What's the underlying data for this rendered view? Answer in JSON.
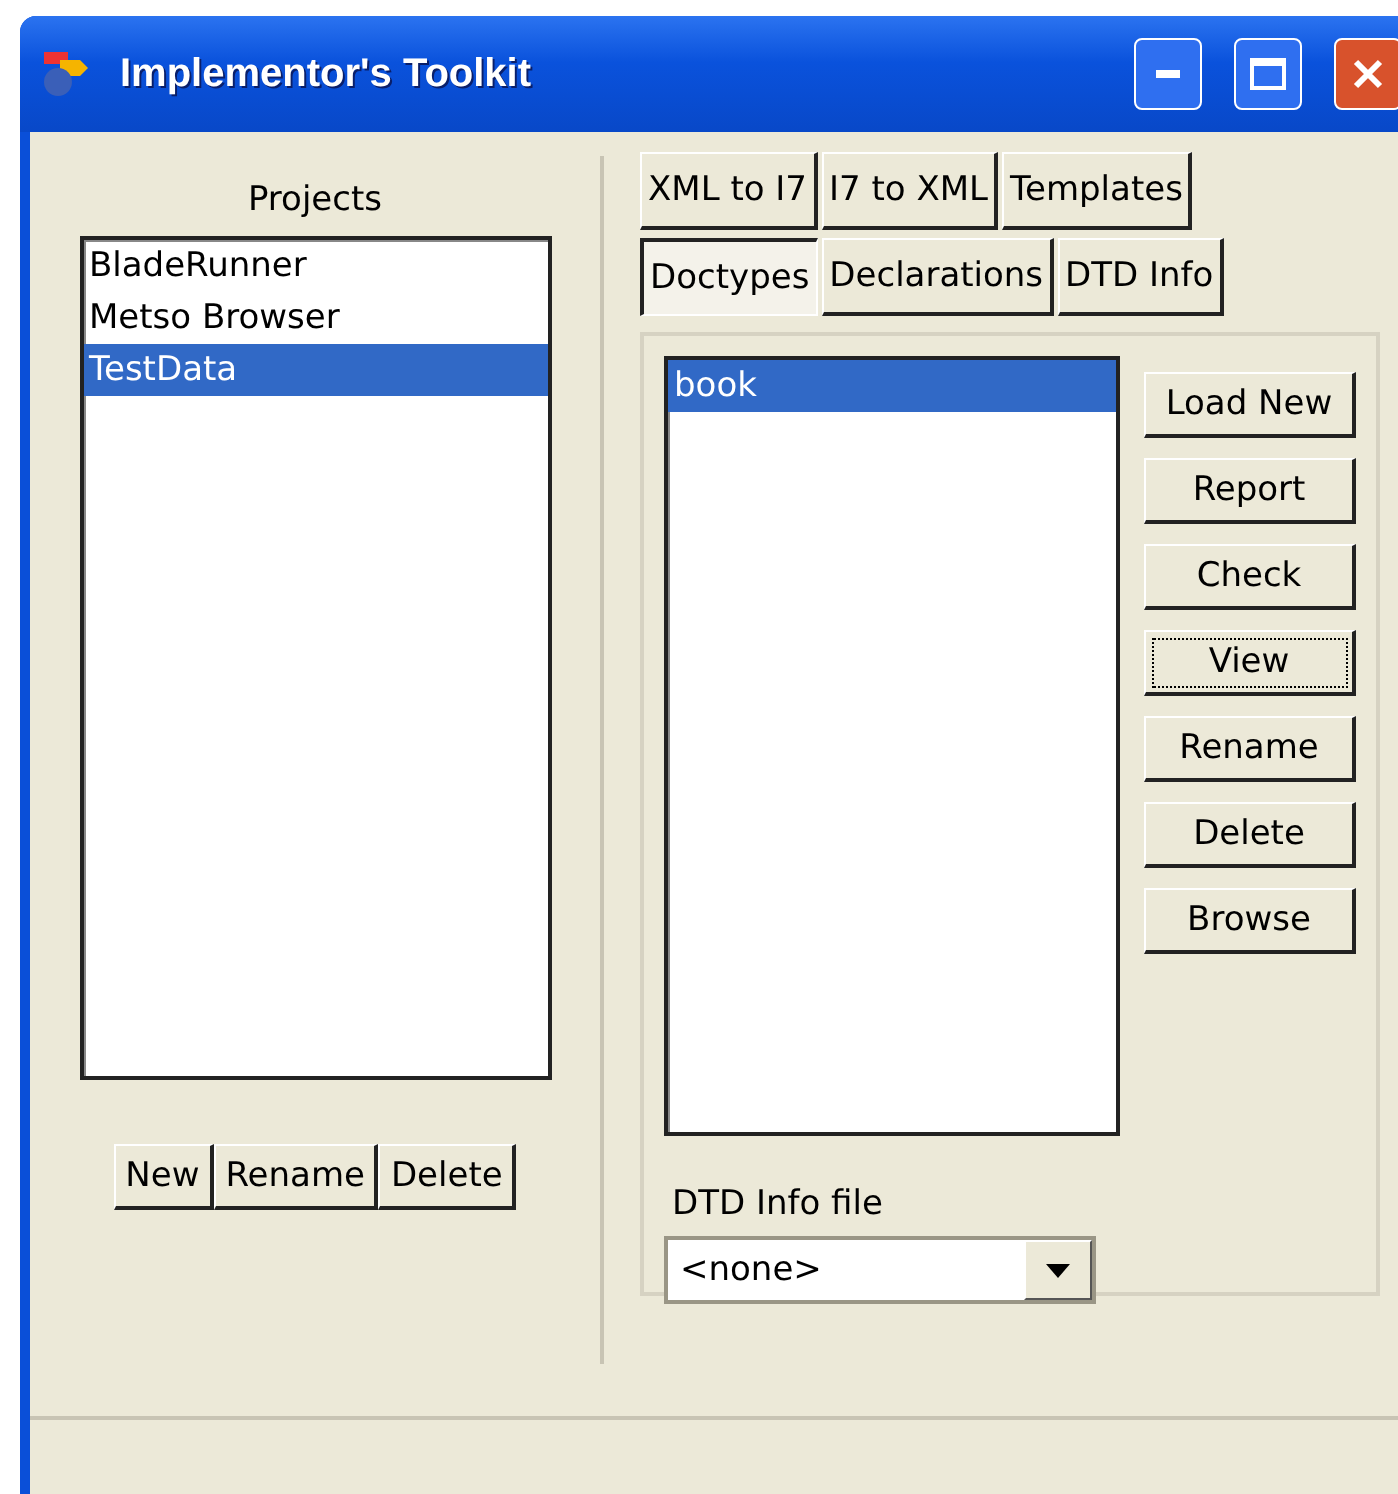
{
  "window": {
    "title": "Implementor's Toolkit"
  },
  "projects": {
    "title": "Projects",
    "items": [
      {
        "label": "BladeRunner",
        "selected": false
      },
      {
        "label": "Metso Browser",
        "selected": false
      },
      {
        "label": "TestData",
        "selected": true
      }
    ],
    "buttons": [
      "New",
      "Rename",
      "Delete"
    ]
  },
  "tab_rows": [
    [
      {
        "label": "XML to I7",
        "selected": false
      },
      {
        "label": "I7 to XML",
        "selected": false
      },
      {
        "label": "Templates",
        "selected": false
      }
    ],
    [
      {
        "label": "Doctypes",
        "selected": true
      },
      {
        "label": "Declarations",
        "selected": false
      },
      {
        "label": "DTD Info",
        "selected": false
      }
    ]
  ],
  "doctypes": {
    "items": [
      {
        "label": "book",
        "selected": true
      }
    ],
    "buttons": [
      {
        "label": "Load New",
        "focused": false
      },
      {
        "label": "Report",
        "focused": false
      },
      {
        "label": "Check",
        "focused": false
      },
      {
        "label": "View",
        "focused": true
      },
      {
        "label": "Rename",
        "focused": false
      },
      {
        "label": "Delete",
        "focused": false
      },
      {
        "label": "Browse",
        "focused": false
      }
    ],
    "dtd_label": "DTD Info file",
    "dtd_value": "<none>"
  }
}
